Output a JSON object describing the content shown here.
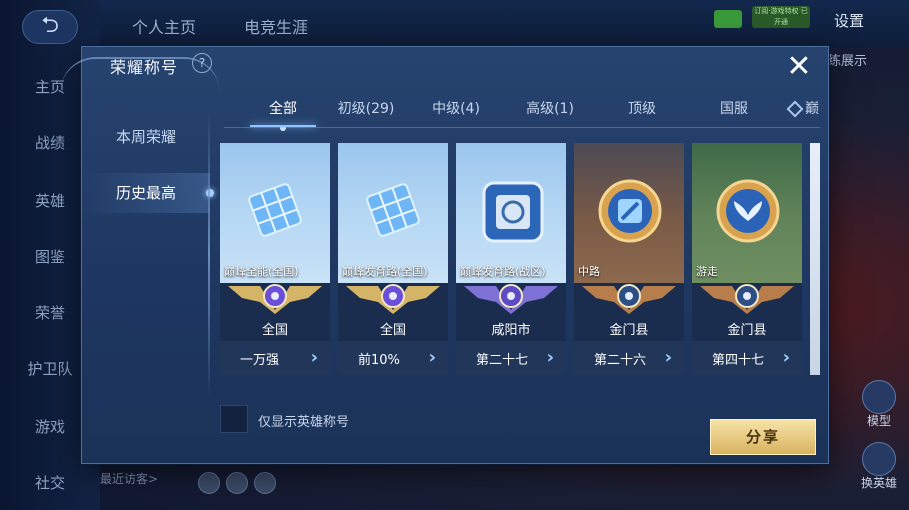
{
  "background": {
    "sidebar_items": [
      "主页",
      "战绩",
      "英雄",
      "图鉴",
      "荣誉",
      "护卫队",
      "游戏",
      "社交"
    ],
    "top_tabs": [
      "个人主页",
      "电竞生涯"
    ],
    "settings_label": "设置",
    "right_text": "练展示",
    "badge_text": "订阅·游戏特权 已开通",
    "bottom_text": "最近访客>",
    "model_label": "模型",
    "switch_hero_label": "换英雄"
  },
  "modal": {
    "title": "荣耀称号",
    "left_nav": [
      {
        "label": "本周荣耀",
        "active": false
      },
      {
        "label": "历史最高",
        "active": true
      }
    ],
    "tabs": [
      {
        "label": "全部",
        "active": true
      },
      {
        "label": "初级(29)",
        "active": false
      },
      {
        "label": "中级(4)",
        "active": false
      },
      {
        "label": "高级(1)",
        "active": false
      },
      {
        "label": "顶级",
        "active": false
      },
      {
        "label": "国服",
        "active": false
      },
      {
        "label": "巅",
        "active": false
      }
    ],
    "cards": [
      {
        "name": "巅峰全能(全国)",
        "region": "全国",
        "rank": "一万强",
        "theme": "sky",
        "emblem": "purple-gold",
        "icon": "cube-icon"
      },
      {
        "name": "巅峰发育路(全国)",
        "region": "全国",
        "rank": "前10%",
        "theme": "sky",
        "emblem": "purple-gold",
        "icon": "cube-icon"
      },
      {
        "name": "巅峰发育路(战区)",
        "region": "咸阳市",
        "rank": "第二十七",
        "theme": "sky",
        "emblem": "purple",
        "icon": "square-emblem-icon"
      },
      {
        "name": "中路",
        "region": "金门县",
        "rank": "第二十六",
        "theme": "dusk",
        "emblem": "bronze",
        "icon": "mid-lane-icon"
      },
      {
        "name": "游走",
        "region": "金门县",
        "rank": "第四十七",
        "theme": "forest",
        "emblem": "bronze",
        "icon": "support-wings-icon"
      }
    ],
    "checkbox_label": "仅显示英雄称号",
    "share_label": "分享"
  },
  "colors": {
    "accent": "#8fc4ff",
    "share_button": "#e6c577"
  }
}
